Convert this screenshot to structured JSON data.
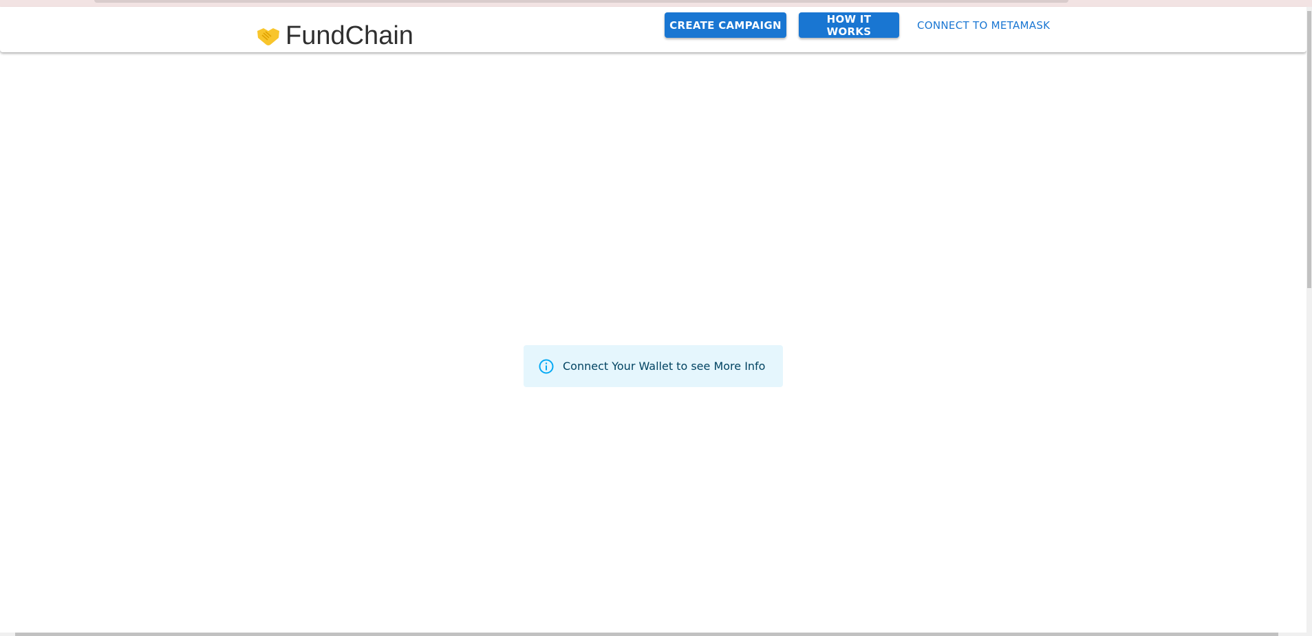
{
  "header": {
    "brand": "FundChain",
    "logo_icon": "handshake-icon",
    "buttons": {
      "create_campaign": "CREATE CAMPAIGN",
      "how_it_works": "HOW IT WORKS",
      "connect_metamask": "CONNECT TO METAMASK"
    }
  },
  "main": {
    "alert": {
      "icon": "info-icon",
      "message": "Connect Your Wallet to see More Info"
    }
  },
  "colors": {
    "primary": "#1976d2",
    "alert_bg": "#e5f6fd",
    "alert_icon": "#03a9f4"
  }
}
